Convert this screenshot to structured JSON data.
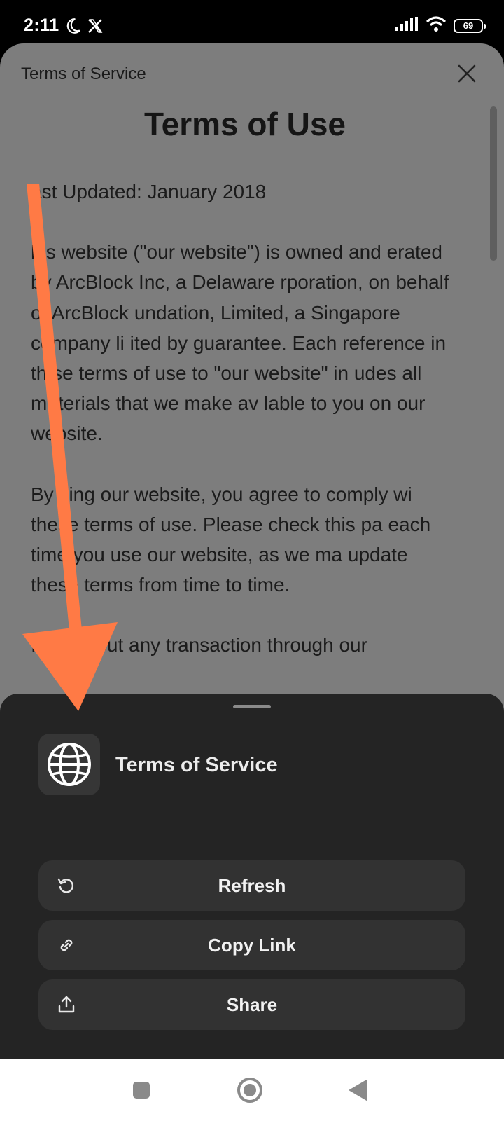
{
  "status_bar": {
    "time": "2:11",
    "battery": "69",
    "icons": [
      "moon-icon",
      "x-logo-icon",
      "signal-icon",
      "wifi-icon",
      "battery-icon"
    ]
  },
  "web_view": {
    "header_title": "Terms of Service",
    "document_title": "Terms of Use",
    "last_updated": "ast Updated: January 2018",
    "paragraph_1": "his website (\"our website\") is owned and erated by ArcBlock Inc, a Delaware rporation, on behalf of ArcBlock undation, Limited, a Singapore company li ited by guarantee. Each reference in th se terms of use to \"our website\" in udes all materials that we make av lable to you on our website.",
    "paragraph_2": "By sing our website, you agree to comply wi these terms of use. Please check this pa each time you use our website, as we ma update these terms from time to time.",
    "paragraph_3": "If carry out any transaction through our"
  },
  "action_sheet": {
    "title": "Terms of Service",
    "actions": [
      {
        "label": "Refresh",
        "icon": "refresh-icon"
      },
      {
        "label": "Copy Link",
        "icon": "link-icon"
      },
      {
        "label": "Share",
        "icon": "share-icon"
      }
    ]
  },
  "colors": {
    "annotation_arrow": "#ff7a45",
    "sheet_background": "#242424",
    "button_background": "#323232"
  }
}
